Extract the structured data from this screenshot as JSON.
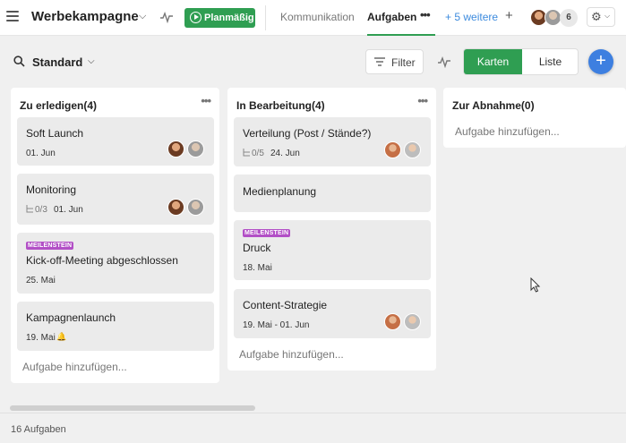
{
  "header": {
    "project_title": "Werbekampagne",
    "status_label": "Planmäßig",
    "tabs": [
      {
        "label": "Kommunikation",
        "active": false
      },
      {
        "label": "Aufgaben",
        "active": true
      }
    ],
    "more_tabs_label": "+ 5 weitere",
    "member_count": "6",
    "accent_color": "#2f9e52"
  },
  "toolbar": {
    "view_name": "Standard",
    "filter_label": "Filter",
    "view_toggle": {
      "cards": "Karten",
      "list": "Liste",
      "selected": "Karten"
    },
    "add_symbol": "+"
  },
  "columns": [
    {
      "title": "Zu erledigen(4)",
      "add_label": "Aufgabe hinzufügen...",
      "cards": [
        {
          "title": "Soft Launch",
          "date": "01. Jun"
        },
        {
          "title": "Monitoring",
          "subtasks": "0/3",
          "date": "01. Jun"
        },
        {
          "milestone": "MEILENSTEIN",
          "title": "Kick-off-Meeting abgeschlossen",
          "date": "25. Mai"
        },
        {
          "title": "Kampagnenlaunch",
          "date": "19. Mai"
        }
      ]
    },
    {
      "title": "In Bearbeitung(4)",
      "add_label": "Aufgabe hinzufügen...",
      "cards": [
        {
          "title": "Verteilung (Post / Stände?)",
          "subtasks": "0/5",
          "date": "24. Jun"
        },
        {
          "title": "Medienplanung"
        },
        {
          "milestone": "MEILENSTEIN",
          "title": "Druck",
          "date": "18. Mai"
        },
        {
          "title": "Content-Strategie",
          "date": "19. Mai - 01. Jun"
        }
      ]
    },
    {
      "title": "Zur Abnahme(0)",
      "add_label": "Aufgabe hinzufügen..."
    }
  ],
  "footer": {
    "task_count": "16 Aufgaben"
  }
}
